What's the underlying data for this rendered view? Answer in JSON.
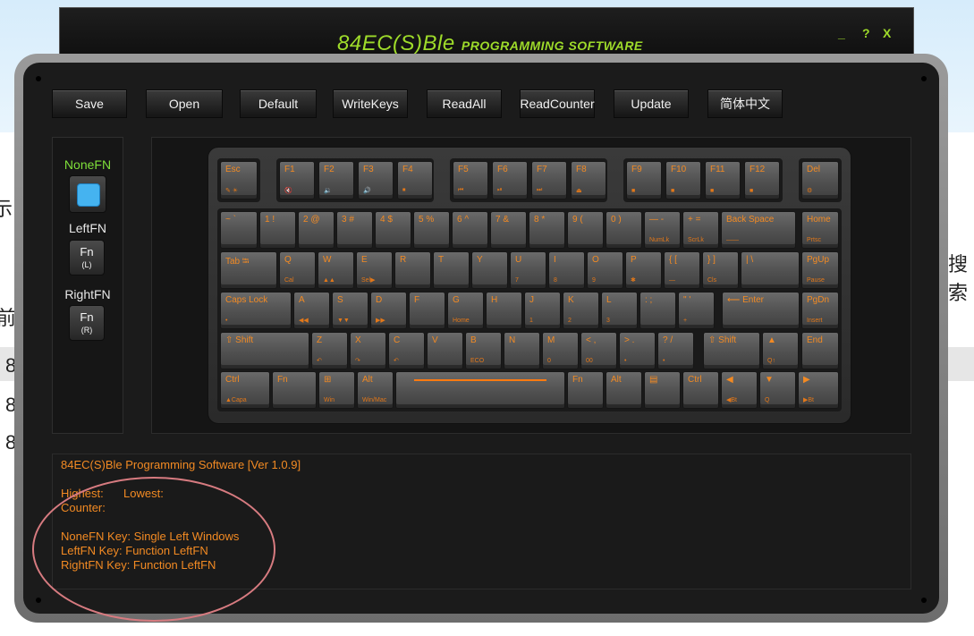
{
  "app": {
    "title_main": "84EC(S)Ble",
    "title_sub": "PROGRAMMING SOFTWARE",
    "minimize": "_",
    "help": "?",
    "close": "X"
  },
  "toolbar": [
    "Save",
    "Open",
    "Default",
    "WriteKeys",
    "ReadAll",
    "ReadCounter",
    "Update",
    "简体中文"
  ],
  "fn": {
    "none_label": "NoneFN",
    "left_label": "LeftFN",
    "right_label": "RightFN",
    "left_key": [
      "Fn",
      "(L)"
    ],
    "right_key": [
      "Fn",
      "(R)"
    ],
    "none_color": "#45b3f0"
  },
  "keyboard": {
    "accent": "#f28a23",
    "rows": [
      [
        [
          "Esc",
          "✎ ☀"
        ],
        [
          "F1",
          "🔇"
        ],
        [
          "F2",
          "🔉"
        ],
        [
          "F3",
          "🔊"
        ],
        [
          "F4",
          "⏹"
        ],
        [
          "F5",
          "⏮"
        ],
        [
          "F6",
          "⏯"
        ],
        [
          "F7",
          "⏭"
        ],
        [
          "F8",
          "⏏"
        ],
        [
          "F9",
          "■"
        ],
        [
          "F10",
          "■"
        ],
        [
          "F11",
          "■"
        ],
        [
          "F12",
          "■"
        ],
        [
          "Del",
          "⚙"
        ]
      ],
      [
        [
          "~ `",
          ""
        ],
        [
          "1 !",
          ""
        ],
        [
          "2 @",
          ""
        ],
        [
          "3 #",
          ""
        ],
        [
          "4 $",
          ""
        ],
        [
          "5 %",
          ""
        ],
        [
          "6 ^",
          ""
        ],
        [
          "7 &",
          ""
        ],
        [
          "8 *",
          ""
        ],
        [
          "9 (",
          ""
        ],
        [
          "0 )",
          ""
        ],
        [
          "— -",
          "NumLk"
        ],
        [
          "+ =",
          "ScrLk"
        ],
        [
          "Back Space",
          "——"
        ],
        [
          "Home",
          "Prtsc"
        ]
      ],
      [
        [
          "Tab ⭾",
          ""
        ],
        [
          "Q",
          "Cal"
        ],
        [
          "W",
          "▲▲"
        ],
        [
          "E",
          "Sel▶"
        ],
        [
          "R",
          ""
        ],
        [
          "T",
          ""
        ],
        [
          "Y",
          ""
        ],
        [
          "U",
          "7"
        ],
        [
          "I",
          "8"
        ],
        [
          "O",
          "9"
        ],
        [
          "P",
          "✱"
        ],
        [
          "{ [",
          "—"
        ],
        [
          "} ]",
          "Cls"
        ],
        [
          "| \\",
          ""
        ],
        [
          "PgUp",
          "Pause"
        ]
      ],
      [
        [
          "Caps Lock",
          "•"
        ],
        [
          "A",
          "◀◀"
        ],
        [
          "S",
          "▼▼"
        ],
        [
          "D",
          "▶▶"
        ],
        [
          "F",
          ""
        ],
        [
          "G",
          "Home"
        ],
        [
          "H",
          ""
        ],
        [
          "J",
          "1"
        ],
        [
          "K",
          "2"
        ],
        [
          "L",
          "3"
        ],
        [
          ": ;",
          ""
        ],
        [
          "\" '",
          "+"
        ],
        [
          "⟵ Enter",
          ""
        ],
        [
          "PgDn",
          "Insert"
        ]
      ],
      [
        [
          "⇧ Shift",
          ""
        ],
        [
          "Z",
          "↶"
        ],
        [
          "X",
          "↷"
        ],
        [
          "C",
          "↶"
        ],
        [
          "V",
          ""
        ],
        [
          "B",
          "ECO"
        ],
        [
          "N",
          ""
        ],
        [
          "M",
          "0"
        ],
        [
          "< ,",
          "00"
        ],
        [
          "> .",
          "•"
        ],
        [
          "? /",
          "•"
        ],
        [
          "⇧ Shift",
          ""
        ],
        [
          "▲",
          "Q↑"
        ],
        [
          "End",
          ""
        ]
      ],
      [
        [
          "Ctrl",
          "▲Capa"
        ],
        [
          "Fn",
          ""
        ],
        [
          "⊞",
          "Win"
        ],
        [
          "Alt",
          "Win/Mac"
        ],
        [
          "",
          ""
        ],
        [
          "Fn",
          ""
        ],
        [
          "Alt",
          ""
        ],
        [
          "▤",
          ""
        ],
        [
          "Ctrl",
          ""
        ],
        [
          "◀",
          "◀Bt"
        ],
        [
          "▼",
          "Q"
        ],
        [
          "▶",
          "▶Bt"
        ]
      ]
    ]
  },
  "log": {
    "version": "84EC(S)Ble Programming Software [Ver 1.0.9]",
    "highest_label": "Highest:",
    "lowest_label": "Lowest:",
    "counter_label": "Counter:",
    "nonefn": "NoneFN Key: Single Left Windows",
    "leftfn": "LeftFN Key: Function LeftFN",
    "rightfn": "RightFN Key: Function LeftFN"
  },
  "background": {
    "left_glyphs": [
      "示",
      "前",
      "8",
      "8",
      "8"
    ],
    "right_glyph": "搜索"
  }
}
